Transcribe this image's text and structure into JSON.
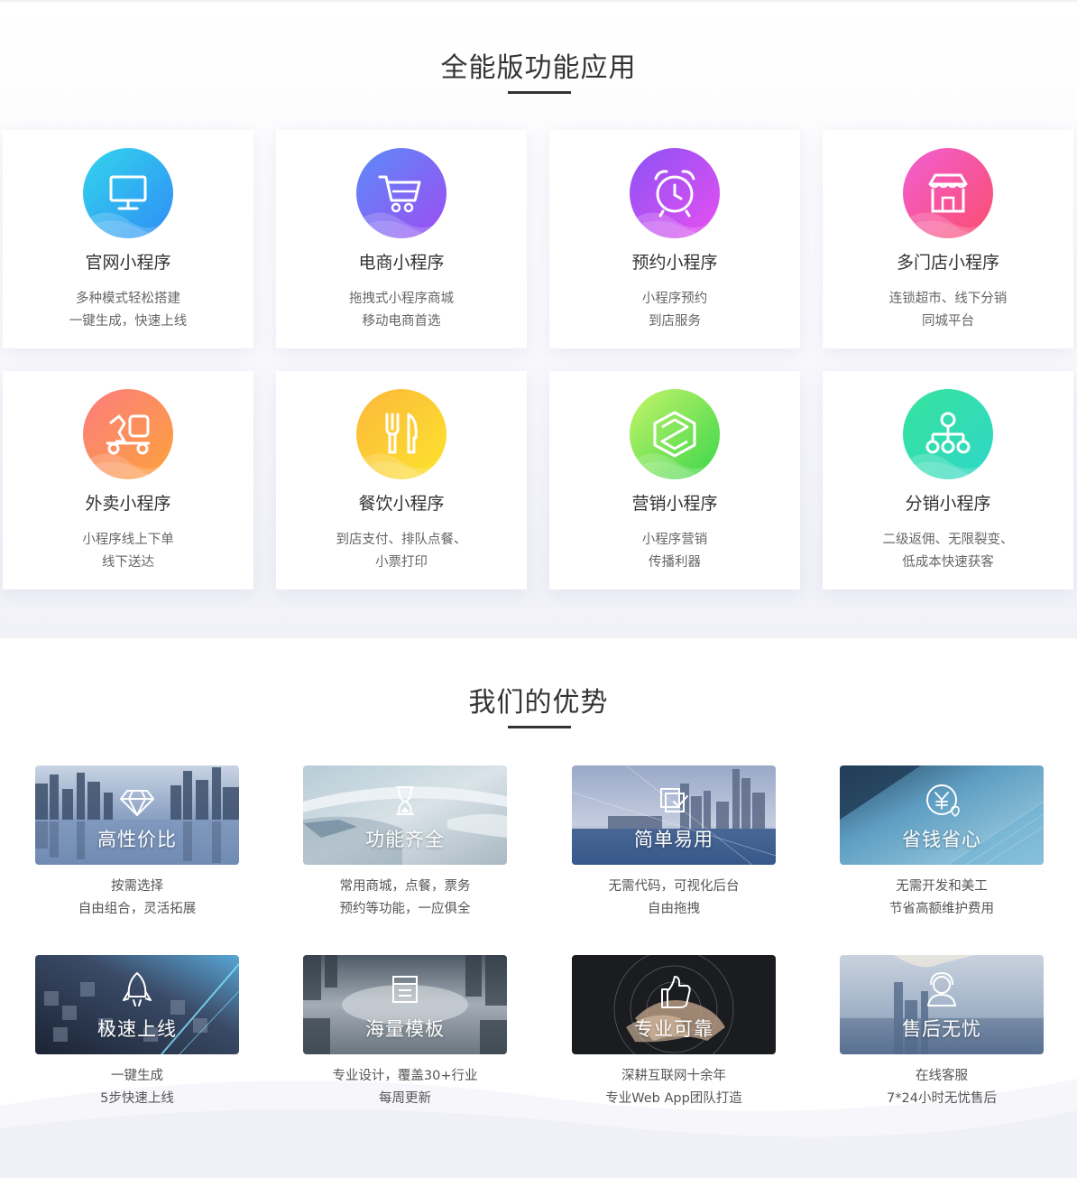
{
  "features": {
    "title": "全能版功能应用",
    "cards": [
      {
        "icon": "monitor-icon",
        "title": "官网小程序",
        "line1": "多种模式轻松搭建",
        "line2": "一键生成，快速上线",
        "colors": [
          "#33d6ec",
          "#2f8cf6"
        ]
      },
      {
        "icon": "shopping-cart-icon",
        "title": "电商小程序",
        "line1": "拖拽式小程序商城",
        "line2": "移动电商首选",
        "colors": [
          "#5b8cf7",
          "#9d4cf3"
        ]
      },
      {
        "icon": "alarm-clock-icon",
        "title": "预约小程序",
        "line1": "小程序预约",
        "line2": "到店服务",
        "colors": [
          "#8a52f6",
          "#e94ff0"
        ]
      },
      {
        "icon": "storefront-icon",
        "title": "多门店小程序",
        "line1": "连锁超市、线下分销",
        "line2": "同城平台",
        "colors": [
          "#f15fd2",
          "#fb4d6e"
        ]
      },
      {
        "icon": "delivery-scooter-icon",
        "title": "外卖小程序",
        "line1": "小程序线上下单",
        "line2": "线下送达",
        "colors": [
          "#fb7c7e",
          "#fda23c"
        ]
      },
      {
        "icon": "fork-knife-icon",
        "title": "餐饮小程序",
        "line1": "到店支付、排队点餐、",
        "line2": "小票打印",
        "colors": [
          "#fcb73c",
          "#fce42c"
        ]
      },
      {
        "icon": "marketing-cube-icon",
        "title": "营销小程序",
        "line1": "小程序营销",
        "line2": "传播利器",
        "colors": [
          "#c6f46a",
          "#3ad64a"
        ]
      },
      {
        "icon": "network-tree-icon",
        "title": "分销小程序",
        "line1": "二级返佣、无限裂变、",
        "line2": "低成本快速获客",
        "colors": [
          "#36e39b",
          "#2fd7c9"
        ]
      }
    ]
  },
  "advantages": {
    "title": "我们的优势",
    "items": [
      {
        "icon": "diamond-icon",
        "title": "高性价比",
        "line1": "按需选择",
        "line2": "自由组合，灵活拓展"
      },
      {
        "icon": "hourglass-icon",
        "title": "功能齐全",
        "line1": "常用商城，点餐，票务",
        "line2": "预约等功能，一应俱全"
      },
      {
        "icon": "layers-check-icon",
        "title": "简单易用",
        "line1": "无需代码，可视化后台",
        "line2": "自由拖拽"
      },
      {
        "icon": "yen-heart-icon",
        "title": "省钱省心",
        "line1": "无需开发和美工",
        "line2": "节省高额维护费用"
      },
      {
        "icon": "rocket-icon",
        "title": "极速上线",
        "line1": "一键生成",
        "line2": "5步快速上线"
      },
      {
        "icon": "template-icon",
        "title": "海量模板",
        "line1": "专业设计，覆盖30+行业",
        "line2": "每周更新"
      },
      {
        "icon": "thumbs-up-icon",
        "title": "专业可靠",
        "line1": "深耕互联网十余年",
        "line2": "专业Web App团队打造"
      },
      {
        "icon": "customer-service-icon",
        "title": "售后无忧",
        "line1": "在线客服",
        "line2": "7*24小时无忧售后"
      }
    ]
  }
}
